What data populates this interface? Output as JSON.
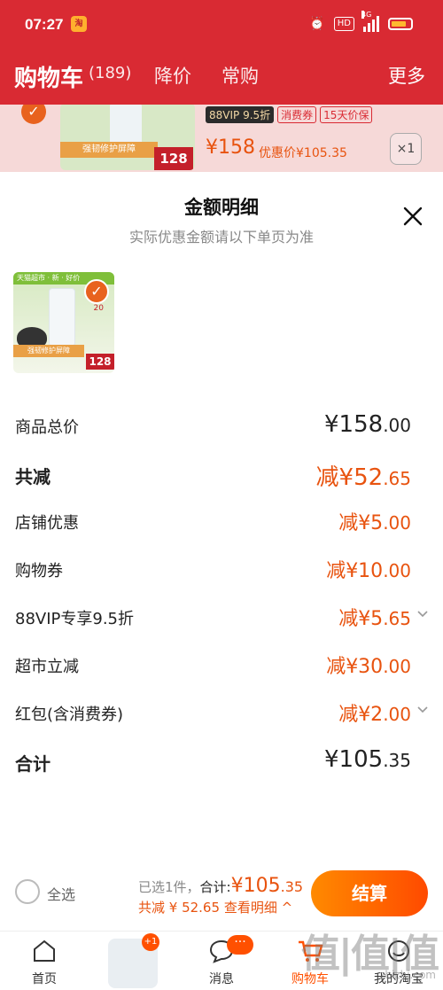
{
  "statusbar": {
    "time": "07:27",
    "app_badge": "淘",
    "hd": "HD",
    "net": "4G"
  },
  "header": {
    "title": "购物车",
    "count": "(189)",
    "tabs": [
      "降价",
      "常购"
    ],
    "more": "更多"
  },
  "bg_item": {
    "tags": [
      "88VIP 9.5折",
      "消费券",
      "15天价保"
    ],
    "thumb_bar": "强韧修护屏障",
    "thumb_price": "128",
    "price": "¥158",
    "promo_price": "优惠价¥105.35",
    "qty": "×1"
  },
  "sheet": {
    "title": "金额明细",
    "subtitle": "实际优惠金额请以下单页为准",
    "thumb": {
      "topbar": "天猫超市 · 新 · 好价",
      "badge": "20",
      "bar": "强韧修护屏障",
      "price": "128"
    },
    "rows": [
      {
        "label": "商品总价",
        "value": "¥158",
        "decimal": ".00",
        "style": "total"
      },
      {
        "label": "共减",
        "value": "减¥52",
        "decimal": ".65",
        "style": "discount-total"
      },
      {
        "label": "店铺优惠",
        "value": "减¥5",
        "decimal": ".00",
        "style": "discount"
      },
      {
        "label": "购物券",
        "value": "减¥10",
        "decimal": ".00",
        "style": "discount"
      },
      {
        "label": "88VIP专享9.5折",
        "value": "减¥5",
        "decimal": ".65",
        "style": "discount",
        "expandable": true
      },
      {
        "label": "超市立减",
        "value": "减¥30",
        "decimal": ".00",
        "style": "discount"
      },
      {
        "label": "红包(含消费券)",
        "value": "减¥2",
        "decimal": ".00",
        "style": "discount",
        "expandable": true
      },
      {
        "label": "合计",
        "value": "¥105",
        "decimal": ".35",
        "style": "total"
      }
    ]
  },
  "footer": {
    "select_all": "全选",
    "selected_prefix": "已选1件，",
    "total_label": "合计:",
    "total_value": "¥105",
    "total_decimal": ".35",
    "discount_text": "共减 ¥ 52.65",
    "details_link": "查看明细 ^",
    "checkout": "结算"
  },
  "tabbar": {
    "items": [
      "首页",
      "",
      "消息",
      "购物车",
      "我的淘宝"
    ],
    "badge_plus": "+1",
    "msg_dots": "···"
  },
  "watermark": {
    "text": "值|值|值",
    "sub": "zhizhi.com"
  },
  "colors": {
    "brand_red": "#d92a33",
    "accent_orange": "#e8530f",
    "checkout_start": "#ff8a00",
    "checkout_end": "#ff4a00"
  }
}
